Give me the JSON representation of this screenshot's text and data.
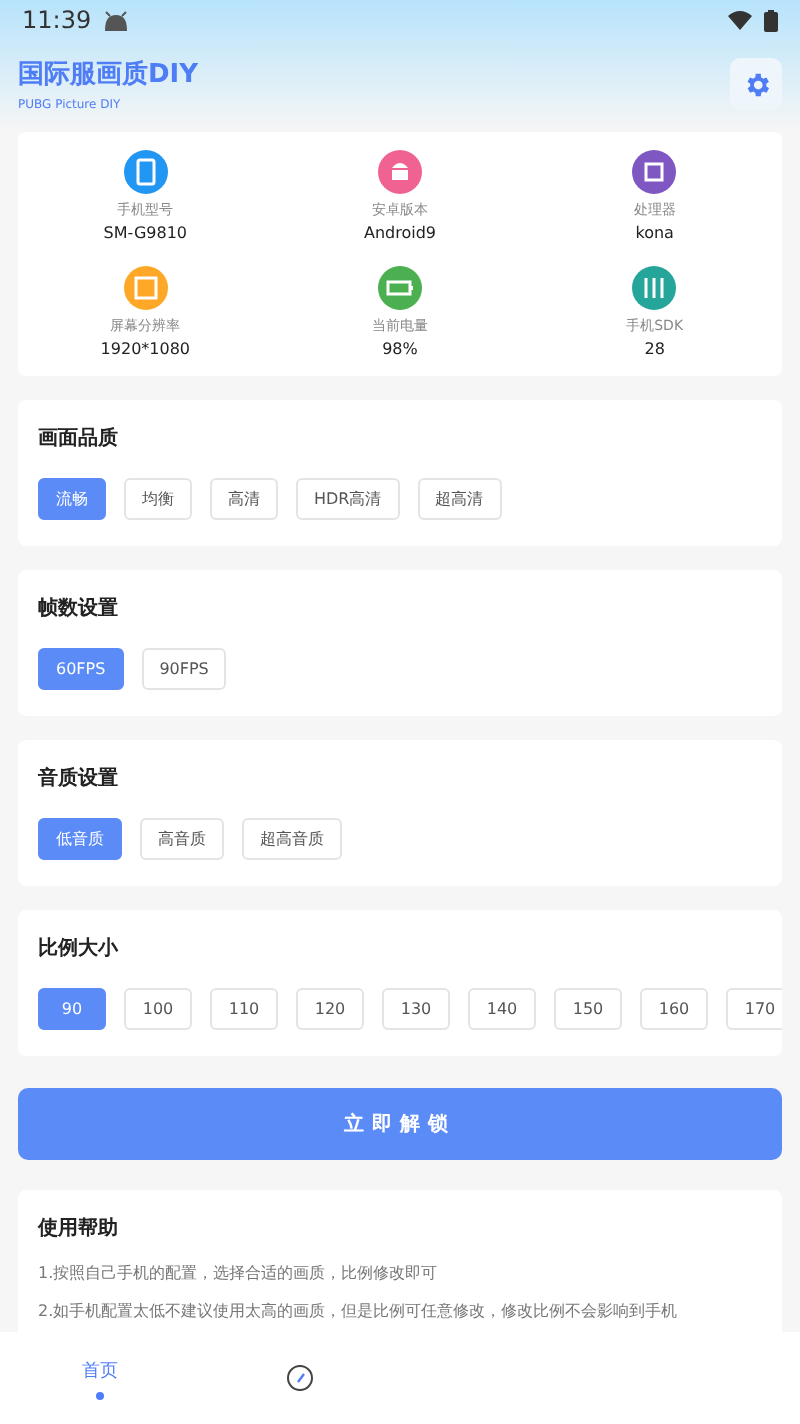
{
  "status_bar": {
    "time": "11:39"
  },
  "header": {
    "title": "国际服画质DIY",
    "subtitle": "PUBG Picture DIY"
  },
  "device_info": [
    {
      "kind": "phone",
      "color": "#2196f3",
      "label": "手机型号",
      "value": "SM-G9810"
    },
    {
      "kind": "android",
      "color": "#f06292",
      "label": "安卓版本",
      "value": "Android9"
    },
    {
      "kind": "chip",
      "color": "#7e57c2",
      "label": "处理器",
      "value": "kona"
    },
    {
      "kind": "screen",
      "color": "#ffa726",
      "label": "屏幕分辨率",
      "value": "1920*1080"
    },
    {
      "kind": "battery",
      "color": "#4caf50",
      "label": "当前电量",
      "value": "98%"
    },
    {
      "kind": "sliders",
      "color": "#26a69a",
      "label": "手机SDK",
      "value": "28"
    }
  ],
  "sections": [
    {
      "title": "画面品质",
      "options": [
        {
          "label": "流畅",
          "selected": true
        },
        {
          "label": "均衡",
          "selected": false
        },
        {
          "label": "高清",
          "selected": false
        },
        {
          "label": "HDR高清",
          "selected": false
        },
        {
          "label": "超高清",
          "selected": false
        }
      ]
    },
    {
      "title": "帧数设置",
      "options": [
        {
          "label": "60FPS",
          "selected": true
        },
        {
          "label": "90FPS",
          "selected": false
        }
      ]
    },
    {
      "title": "音质设置",
      "options": [
        {
          "label": "低音质",
          "selected": true
        },
        {
          "label": "高音质",
          "selected": false
        },
        {
          "label": "超高音质",
          "selected": false
        }
      ]
    },
    {
      "title": "比例大小",
      "options": [
        {
          "label": "90",
          "selected": true
        },
        {
          "label": "100",
          "selected": false
        },
        {
          "label": "110",
          "selected": false
        },
        {
          "label": "120",
          "selected": false
        },
        {
          "label": "130",
          "selected": false
        },
        {
          "label": "140",
          "selected": false
        },
        {
          "label": "150",
          "selected": false
        },
        {
          "label": "160",
          "selected": false
        },
        {
          "label": "170",
          "selected": false
        }
      ]
    }
  ],
  "unlock_button": "立即解锁",
  "help": {
    "title": "使用帮助",
    "lines": [
      "1.按照自己手机的配置，选择合适的画质，比例修改即可",
      "2.如手机配置太低不建议使用太高的画质，但是比例可任意修改，修改比例不会影响到手机"
    ]
  },
  "bottom_nav": [
    {
      "kind": "text",
      "label": "首页",
      "selected": true
    },
    {
      "kind": "compass",
      "selected": false
    }
  ]
}
